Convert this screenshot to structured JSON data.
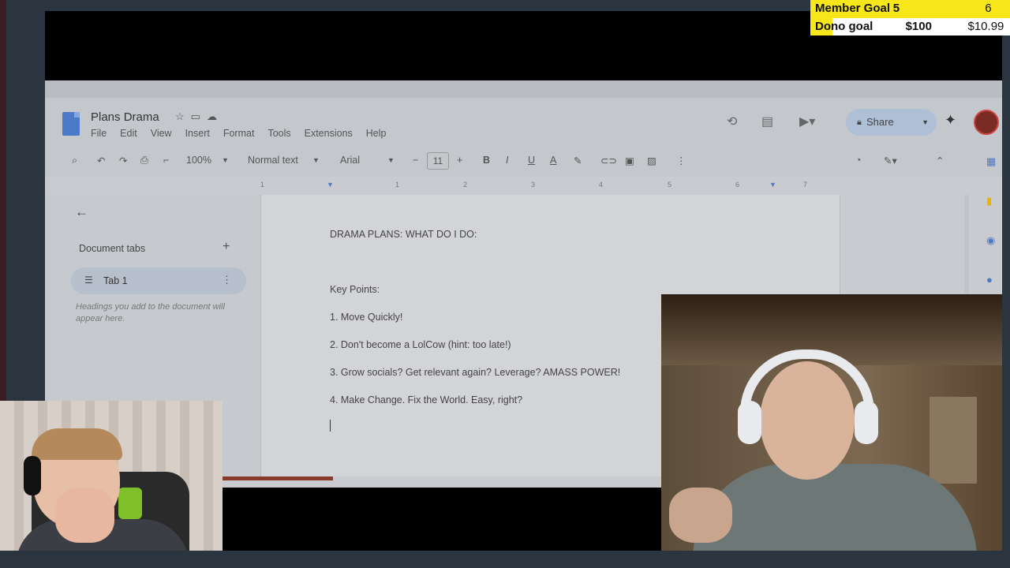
{
  "goals": {
    "member": {
      "label": "Member Goal",
      "current": "6",
      "target": "5",
      "progress": 1.0
    },
    "dono": {
      "label": "Dono goal",
      "current": "$10.99",
      "target": "$100",
      "progress": 0.11
    }
  },
  "docs": {
    "title": "Plans Drama",
    "menu": [
      "File",
      "Edit",
      "View",
      "Insert",
      "Format",
      "Tools",
      "Extensions",
      "Help"
    ],
    "share_label": "Share",
    "toolbar": {
      "zoom": "100%",
      "style": "Normal text",
      "font": "Arial",
      "font_size": "11"
    },
    "ruler_ticks": [
      "1",
      "1",
      "2",
      "3",
      "4",
      "5",
      "6",
      "7"
    ],
    "sidebar": {
      "heading": "Document tabs",
      "tab_name": "Tab 1",
      "hint": "Headings you add to the document will appear here."
    },
    "content": {
      "heading": "DRAMA PLANS:  WHAT DO I DO:",
      "subheading": "Key Points:",
      "points": [
        "1. Move Quickly!",
        "2.  Don't become a LolCow (hint: too late!)",
        "3. Grow socials?  Get relevant again?  Leverage? AMASS POWER!",
        "4. Make Change.  Fix the World. Easy, right?"
      ]
    }
  },
  "colors": {
    "goal_fill": "#f7e61a",
    "share_bg": "#aebfd6",
    "docs_blue": "#4d79c9"
  }
}
